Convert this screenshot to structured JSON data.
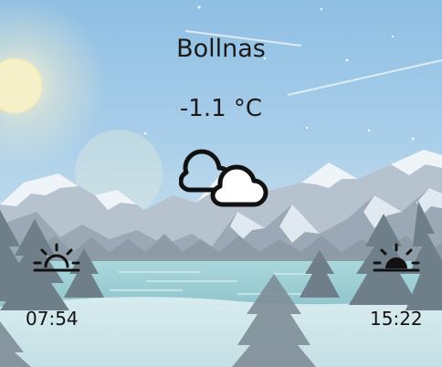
{
  "weather": {
    "city": "Bollnas",
    "temperature": "-1.1 °C",
    "condition_icon": "cloudy-icon"
  },
  "sun": {
    "sunrise": {
      "icon": "sunrise-icon",
      "time": "07:54"
    },
    "sunset": {
      "icon": "sunset-icon",
      "time": "15:22"
    }
  },
  "colors": {
    "sky_top": "#8fbfe3",
    "mountain": "#b9c3d0",
    "snow": "#eef4f8",
    "lake": "#9ccfd6",
    "trees": "#7c8a94"
  }
}
